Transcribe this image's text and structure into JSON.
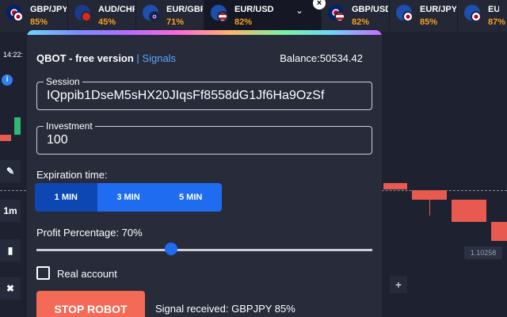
{
  "tabs": [
    {
      "pair": "GBP/JPY",
      "pct": "85%",
      "flag": "f-uk",
      "flag2": "f-jp"
    },
    {
      "pair": "AUD/CHF",
      "pct": "45%",
      "flag": "f-au",
      "flag2": "f-ch"
    },
    {
      "pair": "EUR/GBP",
      "pct": "71%",
      "flag": "f-eu",
      "flag2": "f-uk"
    },
    {
      "pair": "EUR/USD",
      "pct": "82%",
      "flag": "f-eu",
      "flag2": "f-us",
      "active": true
    },
    {
      "pair": "GBP/USD",
      "pct": "82%",
      "flag": "f-uk",
      "flag2": "f-us"
    },
    {
      "pair": "EUR/JPY",
      "pct": "85%",
      "flag": "f-eu",
      "flag2": "f-jp"
    },
    {
      "pair": "EUR/JPY",
      "pct": "87%",
      "flag": "f-eu",
      "flag2": "f-jp"
    }
  ],
  "chart": {
    "time": "14:22:",
    "timeframe": "1m",
    "price_tag": "1.10258",
    "zoom_plus": "+"
  },
  "panel": {
    "title": "QBOT - free version",
    "separator": " | ",
    "signals_link": "Signals",
    "balance": "Balance:50534.42",
    "session_label": "Session",
    "session_value": "IQppib1DseM5sHX20JIqsFf8558dG1Jf6Ha9OzSf",
    "investment_label": "Investment",
    "investment_value": "100",
    "expiration_label": "Expiration time:",
    "expiration_options": [
      "1 MIN",
      "3 MIN",
      "5 MIN"
    ],
    "expiration_selected_index": 0,
    "profit_label": "Profit Percentage: 70%",
    "profit_percentage": 70,
    "real_account_label": "Real account",
    "real_account_checked": false,
    "stop_button": "STOP ROBOT",
    "signal_status": "Signal received: GBPJPY 85%"
  },
  "colors": {
    "accent": "#1f6cf0",
    "stop": "#f36b56",
    "payout": "#f6a123",
    "candle_down": "#e85a4f",
    "candle_up": "#2eb872"
  }
}
